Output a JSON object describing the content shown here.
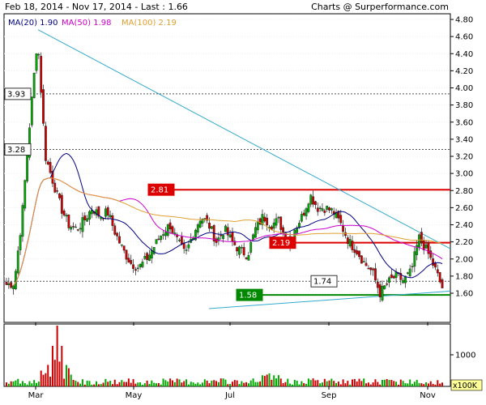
{
  "header": {
    "left": "Feb 18, 2014 - Nov 17, 2014 - Last : 1.66",
    "right": "Charts @ Surperformance.com"
  },
  "chart_data": {
    "type": "candlestick",
    "colors": {
      "up": "#00aa00",
      "down": "#cc0000",
      "ma20": "#000080",
      "ma50": "#cc00cc",
      "ma100": "#e0a030",
      "trend": "#33aacc",
      "resistance": "#dd0000",
      "support": "#008800"
    },
    "legend": [
      {
        "label": "MA(20)",
        "value": "1.90",
        "color": "#000080"
      },
      {
        "label": "MA(50)",
        "value": "1.98",
        "color": "#cc00cc"
      },
      {
        "label": "MA(100)",
        "value": "2.19",
        "color": "#e0a030"
      }
    ],
    "y_ticks": [
      "4.80",
      "4.60",
      "4.40",
      "4.20",
      "4.00",
      "3.80",
      "3.60",
      "3.40",
      "3.20",
      "3.00",
      "2.80",
      "2.60",
      "2.40",
      "2.20",
      "2.00",
      "1.80",
      "1.60"
    ],
    "x_ticks": [
      "Mar",
      "May",
      "Jul",
      "Sep",
      "Nov"
    ],
    "ylim": [
      1.4,
      4.85
    ],
    "volume_tick": "1000",
    "volume_unit": "x100K",
    "horizontal_levels": [
      {
        "label": "3.93",
        "value": 3.93,
        "style": "dashed"
      },
      {
        "label": "3.28",
        "value": 3.28,
        "style": "dashed"
      },
      {
        "label": "2.81",
        "value": 2.81,
        "style": "solid-red"
      },
      {
        "label": "2.19",
        "value": 2.19,
        "style": "solid-red"
      },
      {
        "label": "1.74",
        "value": 1.74,
        "style": "dashed"
      },
      {
        "label": "1.58",
        "value": 1.58,
        "style": "solid-green"
      }
    ],
    "trendlines": [
      {
        "from": [
          "Mar",
          4.68
        ],
        "to": [
          "Nov end",
          2.12
        ]
      },
      {
        "from": [
          "Jun",
          1.42
        ],
        "to": [
          "Nov end",
          1.62
        ]
      }
    ],
    "closes_weekly": [
      1.7,
      1.72,
      2.5,
      3.6,
      4.6,
      3.2,
      2.9,
      2.6,
      2.4,
      2.35,
      2.45,
      2.6,
      2.5,
      2.55,
      2.3,
      2.1,
      1.95,
      1.9,
      2.0,
      2.15,
      2.3,
      2.4,
      2.2,
      2.05,
      2.3,
      2.5,
      2.4,
      2.2,
      2.35,
      2.2,
      2.1,
      2.05,
      2.35,
      2.5,
      2.4,
      2.45,
      2.2,
      2.35,
      2.5,
      2.75,
      2.6,
      2.6,
      2.55,
      2.4,
      2.2,
      2.1,
      1.95,
      1.85,
      1.6,
      1.72,
      1.8,
      1.75,
      1.85,
      2.25,
      2.1,
      1.9,
      1.66
    ]
  }
}
